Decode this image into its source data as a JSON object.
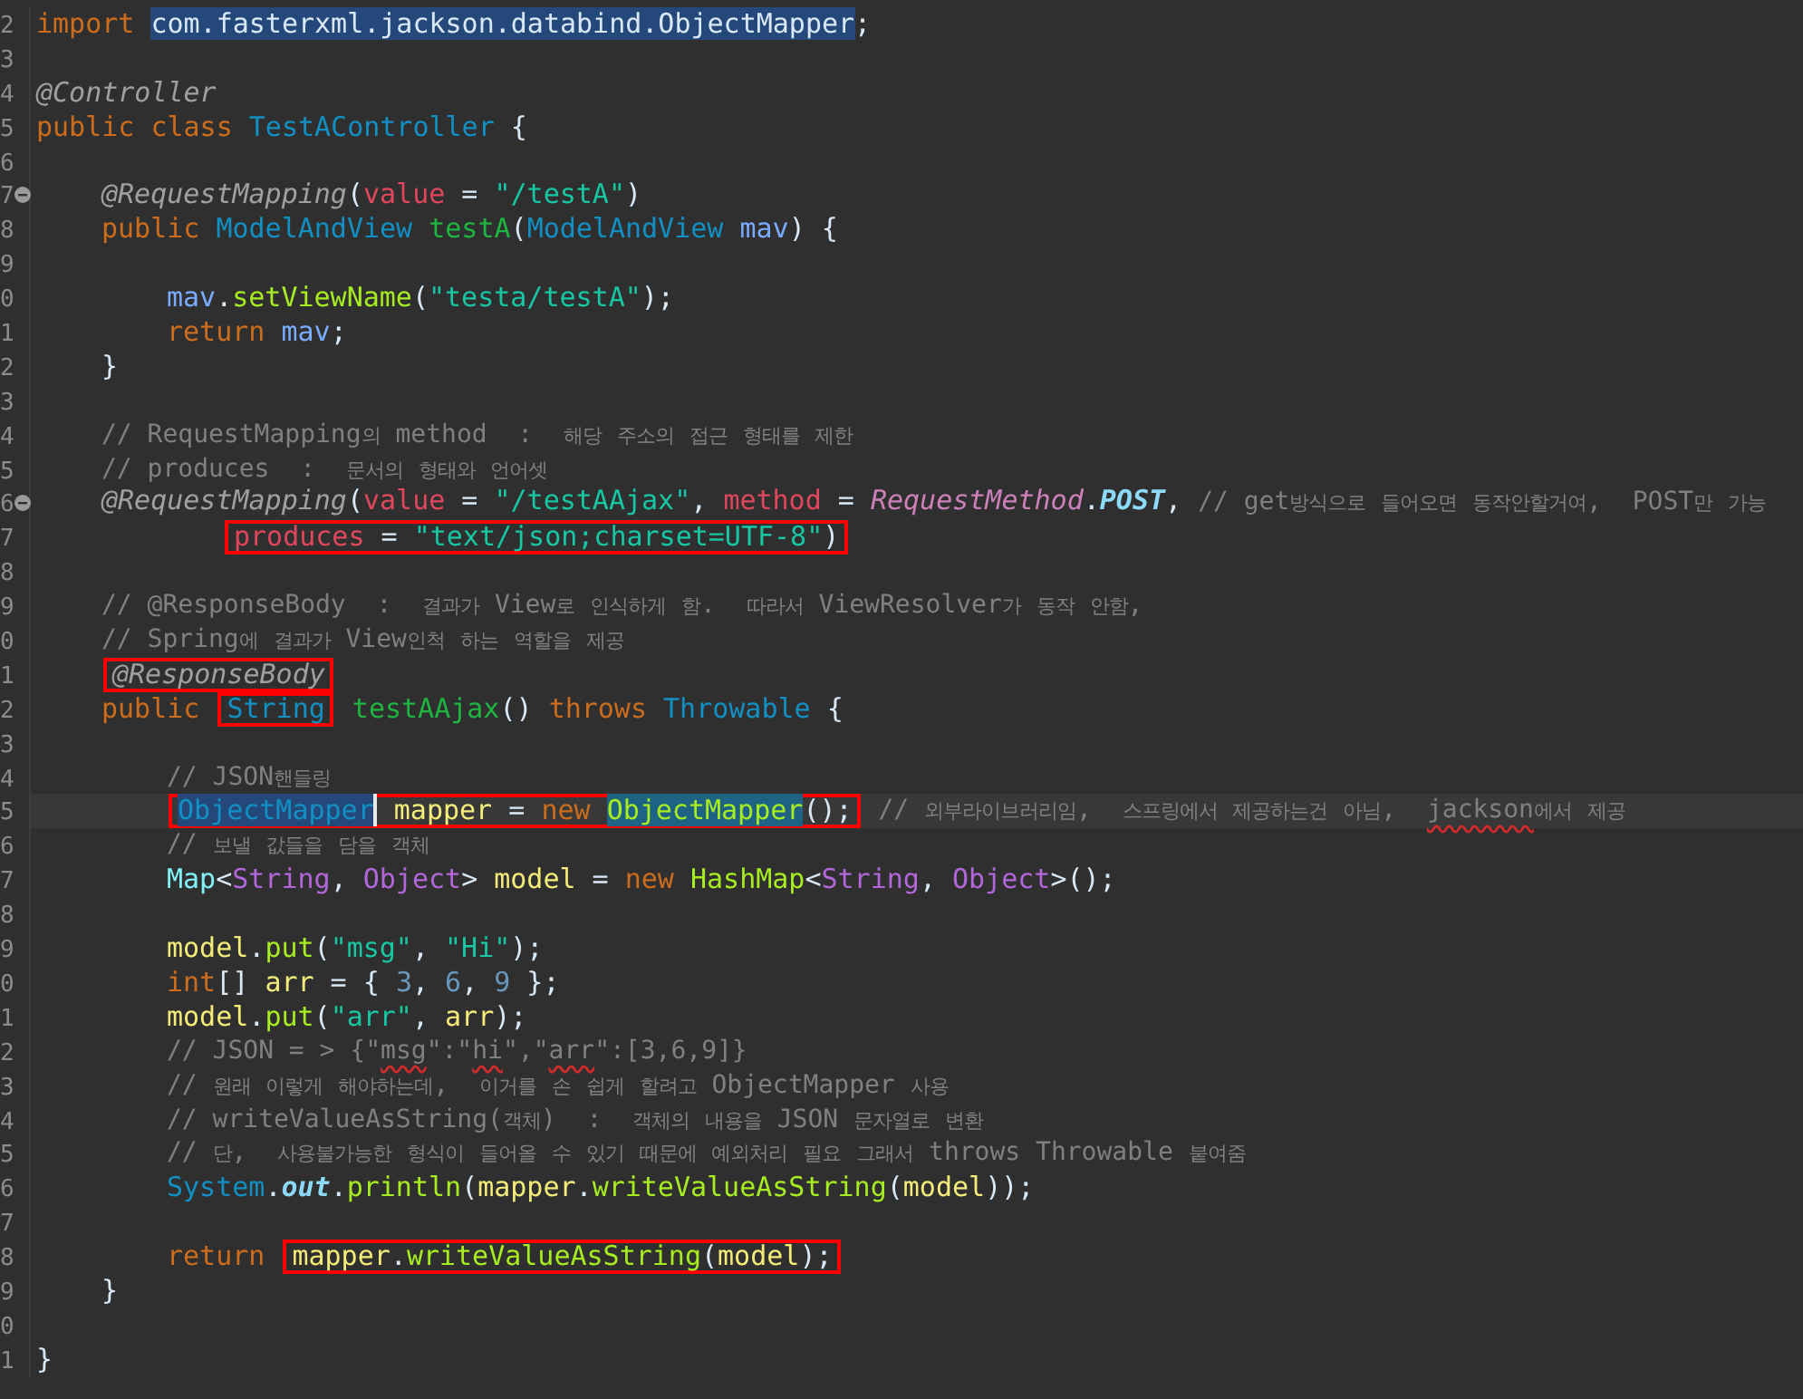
{
  "lines": [
    {
      "number": "2",
      "kind": "top",
      "segments": [
        {
          "boxed": false,
          "tokens": [
            {
              "kind": "keyword",
              "text": "import "
            },
            {
              "kind": "plain",
              "text": "com.fasterxml.jackson.databind.ObjectMapper",
              "selected": true
            },
            {
              "kind": "plain",
              "text": ";"
            }
          ]
        }
      ]
    },
    {
      "number": "3",
      "kind": "top"
    },
    {
      "number": "4",
      "kind": "top",
      "segments": [
        {
          "boxed": false,
          "tokens": [
            {
              "kind": "annotation",
              "text": "@Controller"
            }
          ]
        }
      ]
    },
    {
      "number": "5",
      "kind": "top",
      "segments": [
        {
          "boxed": false,
          "tokens": [
            {
              "kind": "keyword",
              "text": "public class "
            },
            {
              "kind": "type",
              "text": "TestAController"
            },
            {
              "kind": "plain",
              "text": " {"
            }
          ]
        }
      ]
    },
    {
      "number": "6",
      "kind": "top"
    },
    {
      "number": "7",
      "kind": "member",
      "fold": true,
      "segments": [
        {
          "boxed": false,
          "tokens": [
            {
              "kind": "annotation",
              "text": "@RequestMapping"
            },
            {
              "kind": "plain",
              "text": "("
            },
            {
              "kind": "attribute",
              "text": "value"
            },
            {
              "kind": "plain",
              "text": " = "
            },
            {
              "kind": "string",
              "text": "\"/testA\""
            },
            {
              "kind": "plain",
              "text": ")"
            }
          ]
        }
      ]
    },
    {
      "number": "8",
      "kind": "member",
      "segments": [
        {
          "boxed": false,
          "tokens": [
            {
              "kind": "keyword",
              "text": "public "
            },
            {
              "kind": "type",
              "text": "ModelAndView "
            },
            {
              "kind": "method",
              "text": "testA"
            },
            {
              "kind": "plain",
              "text": "("
            },
            {
              "kind": "type",
              "text": "ModelAndView "
            },
            {
              "kind": "parameter",
              "text": "mav"
            },
            {
              "kind": "plain",
              "text": ") {"
            }
          ]
        }
      ]
    },
    {
      "number": "9",
      "kind": "top"
    },
    {
      "number": "0",
      "kind": "body",
      "segments": [
        {
          "boxed": false,
          "tokens": [
            {
              "kind": "parameter",
              "text": "mav"
            },
            {
              "kind": "plain",
              "text": "."
            },
            {
              "kind": "call",
              "text": "setViewName"
            },
            {
              "kind": "plain",
              "text": "("
            },
            {
              "kind": "string",
              "text": "\"testa/testA\""
            },
            {
              "kind": "plain",
              "text": ");"
            }
          ]
        }
      ]
    },
    {
      "number": "1",
      "kind": "body",
      "segments": [
        {
          "boxed": false,
          "tokens": [
            {
              "kind": "keyword",
              "text": "return "
            },
            {
              "kind": "parameter",
              "text": "mav"
            },
            {
              "kind": "plain",
              "text": ";"
            }
          ]
        }
      ]
    },
    {
      "number": "2",
      "kind": "member",
      "segments": [
        {
          "boxed": false,
          "tokens": [
            {
              "kind": "plain",
              "text": "}"
            }
          ]
        }
      ]
    },
    {
      "number": "3",
      "kind": "top"
    },
    {
      "number": "4",
      "kind": "member",
      "segments": [
        {
          "boxed": false,
          "tokens": [
            {
              "kind": "comment",
              "text": "// RequestMapping의 method  :  해당 주소의 접근 형태를 제한"
            }
          ]
        }
      ]
    },
    {
      "number": "5",
      "kind": "member",
      "segments": [
        {
          "boxed": false,
          "tokens": [
            {
              "kind": "comment",
              "text": "// produces  :  문서의 형태와 언어셋"
            }
          ]
        }
      ]
    },
    {
      "number": "6",
      "kind": "member",
      "fold": true,
      "segments": [
        {
          "boxed": false,
          "tokens": [
            {
              "kind": "annotation",
              "text": "@RequestMapping"
            },
            {
              "kind": "plain",
              "text": "("
            },
            {
              "kind": "attribute",
              "text": "value"
            },
            {
              "kind": "plain",
              "text": " = "
            },
            {
              "kind": "string",
              "text": "\"/testAAjax\""
            },
            {
              "kind": "plain",
              "text": ", "
            },
            {
              "kind": "attribute",
              "text": "method"
            },
            {
              "kind": "plain",
              "text": " = "
            },
            {
              "kind": "enum",
              "text": "RequestMethod"
            },
            {
              "kind": "plain",
              "text": "."
            },
            {
              "kind": "constant",
              "text": "POST"
            },
            {
              "kind": "plain",
              "text": ", "
            },
            {
              "kind": "comment",
              "text": "// get방식으로 들어오면 동작안할거여,  POST만 가능"
            }
          ]
        }
      ]
    },
    {
      "number": "7",
      "kind": "continuation",
      "segments": [
        {
          "boxed": true,
          "tokens": [
            {
              "kind": "attribute",
              "text": "produces"
            },
            {
              "kind": "plain",
              "text": " = "
            },
            {
              "kind": "string",
              "text": "\"text/json;charset=UTF-8\""
            },
            {
              "kind": "plain",
              "text": ")"
            }
          ]
        }
      ]
    },
    {
      "number": "8",
      "kind": "top"
    },
    {
      "number": "9",
      "kind": "member",
      "segments": [
        {
          "boxed": false,
          "tokens": [
            {
              "kind": "comment",
              "text": "// @ResponseBody  :  결과가 View로 인식하게 함.  따라서 ViewResolver가 동작 안함,"
            }
          ]
        }
      ]
    },
    {
      "number": "0",
      "kind": "member",
      "segments": [
        {
          "boxed": false,
          "tokens": [
            {
              "kind": "comment",
              "text": "// Spring에 결과가 View인척 하는 역할을 제공"
            }
          ]
        }
      ]
    },
    {
      "number": "1",
      "kind": "member",
      "segments": [
        {
          "boxed": true,
          "tokens": [
            {
              "kind": "annotation",
              "text": "@ResponseBody"
            }
          ]
        }
      ]
    },
    {
      "number": "2",
      "kind": "member",
      "segments": [
        {
          "boxed": false,
          "tokens": [
            {
              "kind": "keyword",
              "text": "public "
            }
          ]
        },
        {
          "boxed": true,
          "tokens": [
            {
              "kind": "type",
              "text": "String"
            }
          ]
        },
        {
          "boxed": false,
          "tokens": [
            {
              "kind": "method",
              "text": " testAAjax"
            },
            {
              "kind": "plain",
              "text": "() "
            },
            {
              "kind": "keyword",
              "text": "throws "
            },
            {
              "kind": "type",
              "text": "Throwable"
            },
            {
              "kind": "plain",
              "text": " {"
            }
          ]
        }
      ]
    },
    {
      "number": "3",
      "kind": "top"
    },
    {
      "number": "4",
      "kind": "body",
      "segments": [
        {
          "boxed": false,
          "tokens": [
            {
              "kind": "comment",
              "text": "// JSON핸들링"
            }
          ]
        }
      ]
    },
    {
      "number": "5",
      "kind": "body",
      "current": true,
      "segments": [
        {
          "boxed": true,
          "tokens": [
            {
              "kind": "type",
              "text": "ObjectMapper",
              "selected": true,
              "caret": true
            },
            {
              "kind": "variable",
              "text": " mapper"
            },
            {
              "kind": "plain",
              "text": " = "
            },
            {
              "kind": "keyword",
              "text": "new "
            },
            {
              "kind": "call",
              "text": "ObjectMapper",
              "occurrence": true
            },
            {
              "kind": "plain",
              "text": "();"
            }
          ]
        },
        {
          "boxed": false,
          "tokens": [
            {
              "kind": "comment",
              "text": " // 외부라이브러리임,  스프링에서 제공하는건 아님,  "
            },
            {
              "kind": "comment",
              "text": "jackson",
              "misspelled": true
            },
            {
              "kind": "comment",
              "text": "에서 제공"
            }
          ]
        }
      ]
    },
    {
      "number": "6",
      "kind": "body",
      "segments": [
        {
          "boxed": false,
          "tokens": [
            {
              "kind": "comment",
              "text": "// 보낼 값들을 담을 객체"
            }
          ]
        }
      ]
    },
    {
      "number": "7",
      "kind": "body",
      "segments": [
        {
          "boxed": false,
          "tokens": [
            {
              "kind": "interface",
              "text": "Map"
            },
            {
              "kind": "plain",
              "text": "<"
            },
            {
              "kind": "class",
              "text": "String"
            },
            {
              "kind": "plain",
              "text": ", "
            },
            {
              "kind": "class",
              "text": "Object"
            },
            {
              "kind": "plain",
              "text": "> "
            },
            {
              "kind": "variable",
              "text": "model"
            },
            {
              "kind": "plain",
              "text": " = "
            },
            {
              "kind": "keyword",
              "text": "new "
            },
            {
              "kind": "call",
              "text": "HashMap"
            },
            {
              "kind": "plain",
              "text": "<"
            },
            {
              "kind": "class",
              "text": "String"
            },
            {
              "kind": "plain",
              "text": ", "
            },
            {
              "kind": "class",
              "text": "Object"
            },
            {
              "kind": "plain",
              "text": ">();"
            }
          ]
        }
      ]
    },
    {
      "number": "8",
      "kind": "top"
    },
    {
      "number": "9",
      "kind": "body",
      "segments": [
        {
          "boxed": false,
          "tokens": [
            {
              "kind": "variable",
              "text": "model"
            },
            {
              "kind": "plain",
              "text": "."
            },
            {
              "kind": "call",
              "text": "put"
            },
            {
              "kind": "plain",
              "text": "("
            },
            {
              "kind": "string",
              "text": "\"msg\""
            },
            {
              "kind": "plain",
              "text": ", "
            },
            {
              "kind": "string",
              "text": "\"Hi\""
            },
            {
              "kind": "plain",
              "text": ");"
            }
          ]
        }
      ]
    },
    {
      "number": "0",
      "kind": "body",
      "segments": [
        {
          "boxed": false,
          "tokens": [
            {
              "kind": "keyword",
              "text": "int"
            },
            {
              "kind": "plain",
              "text": "[] "
            },
            {
              "kind": "variable",
              "text": "arr"
            },
            {
              "kind": "plain",
              "text": " = { "
            },
            {
              "kind": "number",
              "text": "3"
            },
            {
              "kind": "plain",
              "text": ", "
            },
            {
              "kind": "number",
              "text": "6"
            },
            {
              "kind": "plain",
              "text": ", "
            },
            {
              "kind": "number",
              "text": "9"
            },
            {
              "kind": "plain",
              "text": " };"
            }
          ]
        }
      ]
    },
    {
      "number": "1",
      "kind": "body",
      "segments": [
        {
          "boxed": false,
          "tokens": [
            {
              "kind": "variable",
              "text": "model"
            },
            {
              "kind": "plain",
              "text": "."
            },
            {
              "kind": "call",
              "text": "put"
            },
            {
              "kind": "plain",
              "text": "("
            },
            {
              "kind": "string",
              "text": "\"arr\""
            },
            {
              "kind": "plain",
              "text": ", "
            },
            {
              "kind": "variable",
              "text": "arr"
            },
            {
              "kind": "plain",
              "text": ");"
            }
          ]
        }
      ]
    },
    {
      "number": "2",
      "kind": "body",
      "segments": [
        {
          "boxed": false,
          "tokens": [
            {
              "kind": "comment",
              "text": "// JSON = > {\""
            },
            {
              "kind": "comment",
              "text": "msg",
              "misspelled": true
            },
            {
              "kind": "comment",
              "text": "\":\""
            },
            {
              "kind": "comment",
              "text": "hi",
              "misspelled": true
            },
            {
              "kind": "comment",
              "text": "\",\""
            },
            {
              "kind": "comment",
              "text": "arr",
              "misspelled": true
            },
            {
              "kind": "comment",
              "text": "\":[3,6,9]}"
            }
          ]
        }
      ]
    },
    {
      "number": "3",
      "kind": "body",
      "segments": [
        {
          "boxed": false,
          "tokens": [
            {
              "kind": "comment",
              "text": "// 원래 이렇게 해야하는데,  이거를 손 쉽게 할려고 ObjectMapper 사용"
            }
          ]
        }
      ]
    },
    {
      "number": "4",
      "kind": "body",
      "segments": [
        {
          "boxed": false,
          "tokens": [
            {
              "kind": "comment",
              "text": "// writeValueAsString(객체)  :  객체의 내용을 JSON 문자열로 변환"
            }
          ]
        }
      ]
    },
    {
      "number": "5",
      "kind": "body",
      "segments": [
        {
          "boxed": false,
          "tokens": [
            {
              "kind": "comment",
              "text": "// 단,  사용불가능한 형식이 들어올 수 있기 때문에 예외처리 필요 그래서 throws Throwable 붙여줌"
            }
          ]
        }
      ]
    },
    {
      "number": "6",
      "kind": "body",
      "segments": [
        {
          "boxed": false,
          "tokens": [
            {
              "kind": "type",
              "text": "System"
            },
            {
              "kind": "plain",
              "text": "."
            },
            {
              "kind": "constant",
              "text": "out"
            },
            {
              "kind": "plain",
              "text": "."
            },
            {
              "kind": "call",
              "text": "println"
            },
            {
              "kind": "plain",
              "text": "("
            },
            {
              "kind": "variable",
              "text": "mapper"
            },
            {
              "kind": "plain",
              "text": "."
            },
            {
              "kind": "call",
              "text": "writeValueAsString"
            },
            {
              "kind": "plain",
              "text": "("
            },
            {
              "kind": "variable",
              "text": "model"
            },
            {
              "kind": "plain",
              "text": "));"
            }
          ]
        }
      ]
    },
    {
      "number": "7",
      "kind": "top"
    },
    {
      "number": "8",
      "kind": "body",
      "segments": [
        {
          "boxed": false,
          "tokens": [
            {
              "kind": "keyword",
              "text": "return "
            }
          ]
        },
        {
          "boxed": true,
          "tokens": [
            {
              "kind": "variable",
              "text": "mapper"
            },
            {
              "kind": "plain",
              "text": "."
            },
            {
              "kind": "call",
              "text": "writeValueAsString"
            },
            {
              "kind": "plain",
              "text": "("
            },
            {
              "kind": "variable",
              "text": "model"
            },
            {
              "kind": "plain",
              "text": ");"
            }
          ]
        }
      ]
    },
    {
      "number": "9",
      "kind": "member",
      "segments": [
        {
          "boxed": false,
          "tokens": [
            {
              "kind": "plain",
              "text": "}"
            }
          ]
        }
      ]
    },
    {
      "number": "0",
      "kind": "top"
    },
    {
      "number": "1",
      "kind": "top",
      "segments": [
        {
          "boxed": false,
          "tokens": [
            {
              "kind": "plain",
              "text": "}"
            }
          ]
        }
      ]
    }
  ]
}
